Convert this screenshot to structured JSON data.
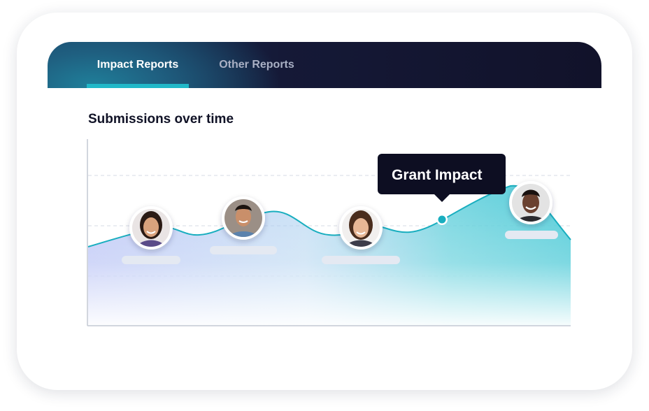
{
  "tabs": [
    {
      "label": "Impact Reports",
      "active": true
    },
    {
      "label": "Other Reports",
      "active": false
    }
  ],
  "chart_title": "Submissions over time",
  "tooltip": {
    "label": "Grant Impact"
  },
  "avatars": [
    {
      "name": "avatar-woman-1",
      "skin": "#d9a27d",
      "hair": "#2a1a14",
      "shirt": "#5a4b88"
    },
    {
      "name": "avatar-man-1",
      "skin": "#c98f6a",
      "hair": "#1c1410",
      "shirt": "#5b82ad"
    },
    {
      "name": "avatar-woman-2",
      "skin": "#e7b796",
      "hair": "#4a2d1d",
      "shirt": "#3d3d4a"
    },
    {
      "name": "avatar-man-2",
      "skin": "#6a4130",
      "hair": "#1a1210",
      "shirt": "#2a2a2e"
    }
  ],
  "colors": {
    "accent": "#21b8c8",
    "line": "#19aebf",
    "tooltip_bg": "#0d0e22",
    "title": "#101226",
    "placeholder_bar": "#e4e9f2"
  }
}
